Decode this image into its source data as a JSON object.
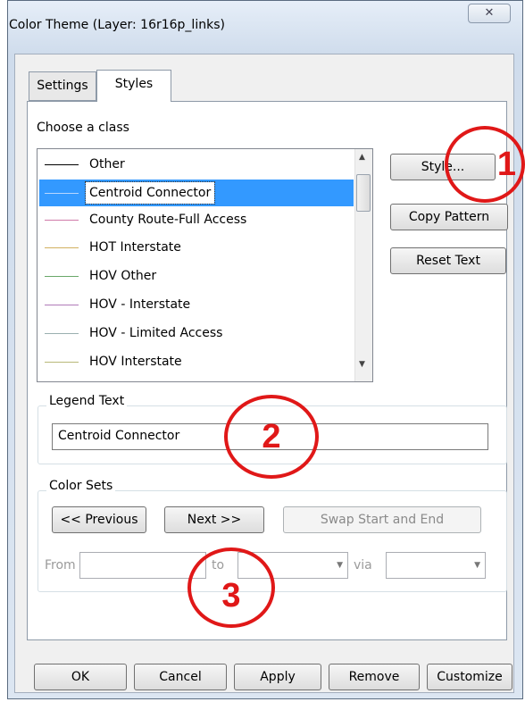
{
  "window": {
    "title": "Color Theme (Layer: 16r16p_links)",
    "close_glyph": "✕"
  },
  "tabs": [
    {
      "label": "Settings"
    },
    {
      "label": "Styles"
    }
  ],
  "class_section": {
    "label": "Choose a class"
  },
  "classes": [
    {
      "label": "Other",
      "color": "#000000"
    },
    {
      "label": "Centroid Connector",
      "color": "#8fb3e0"
    },
    {
      "label": "County Route-Full Access",
      "color": "#d07aa8"
    },
    {
      "label": "HOT Interstate",
      "color": "#d2b060"
    },
    {
      "label": "HOV  Other",
      "color": "#6aa86a"
    },
    {
      "label": "HOV - Interstate",
      "color": "#b07ab8"
    },
    {
      "label": "HOV - Limited Access",
      "color": "#9ab0b0"
    },
    {
      "label": "HOV Interstate",
      "color": "#b8b878"
    }
  ],
  "side_buttons": {
    "style": "Style...",
    "copy_pattern": "Copy Pattern",
    "reset_text": "Reset Text"
  },
  "legend": {
    "group_label": "Legend Text",
    "value": "Centroid Connector"
  },
  "color_sets": {
    "group_label": "Color Sets",
    "previous": "<< Previous",
    "next": "Next >>",
    "swap": "Swap Start and End",
    "from_label": "From",
    "to_label": "to",
    "via_label": "via"
  },
  "footer": {
    "ok": "OK",
    "cancel": "Cancel",
    "apply": "Apply",
    "remove": "Remove",
    "customize": "Customize"
  },
  "annotations": [
    {
      "label": "1"
    },
    {
      "label": "2"
    },
    {
      "label": "3"
    }
  ],
  "colors": {
    "annotation": "#e01818",
    "selection": "#3399ff"
  }
}
